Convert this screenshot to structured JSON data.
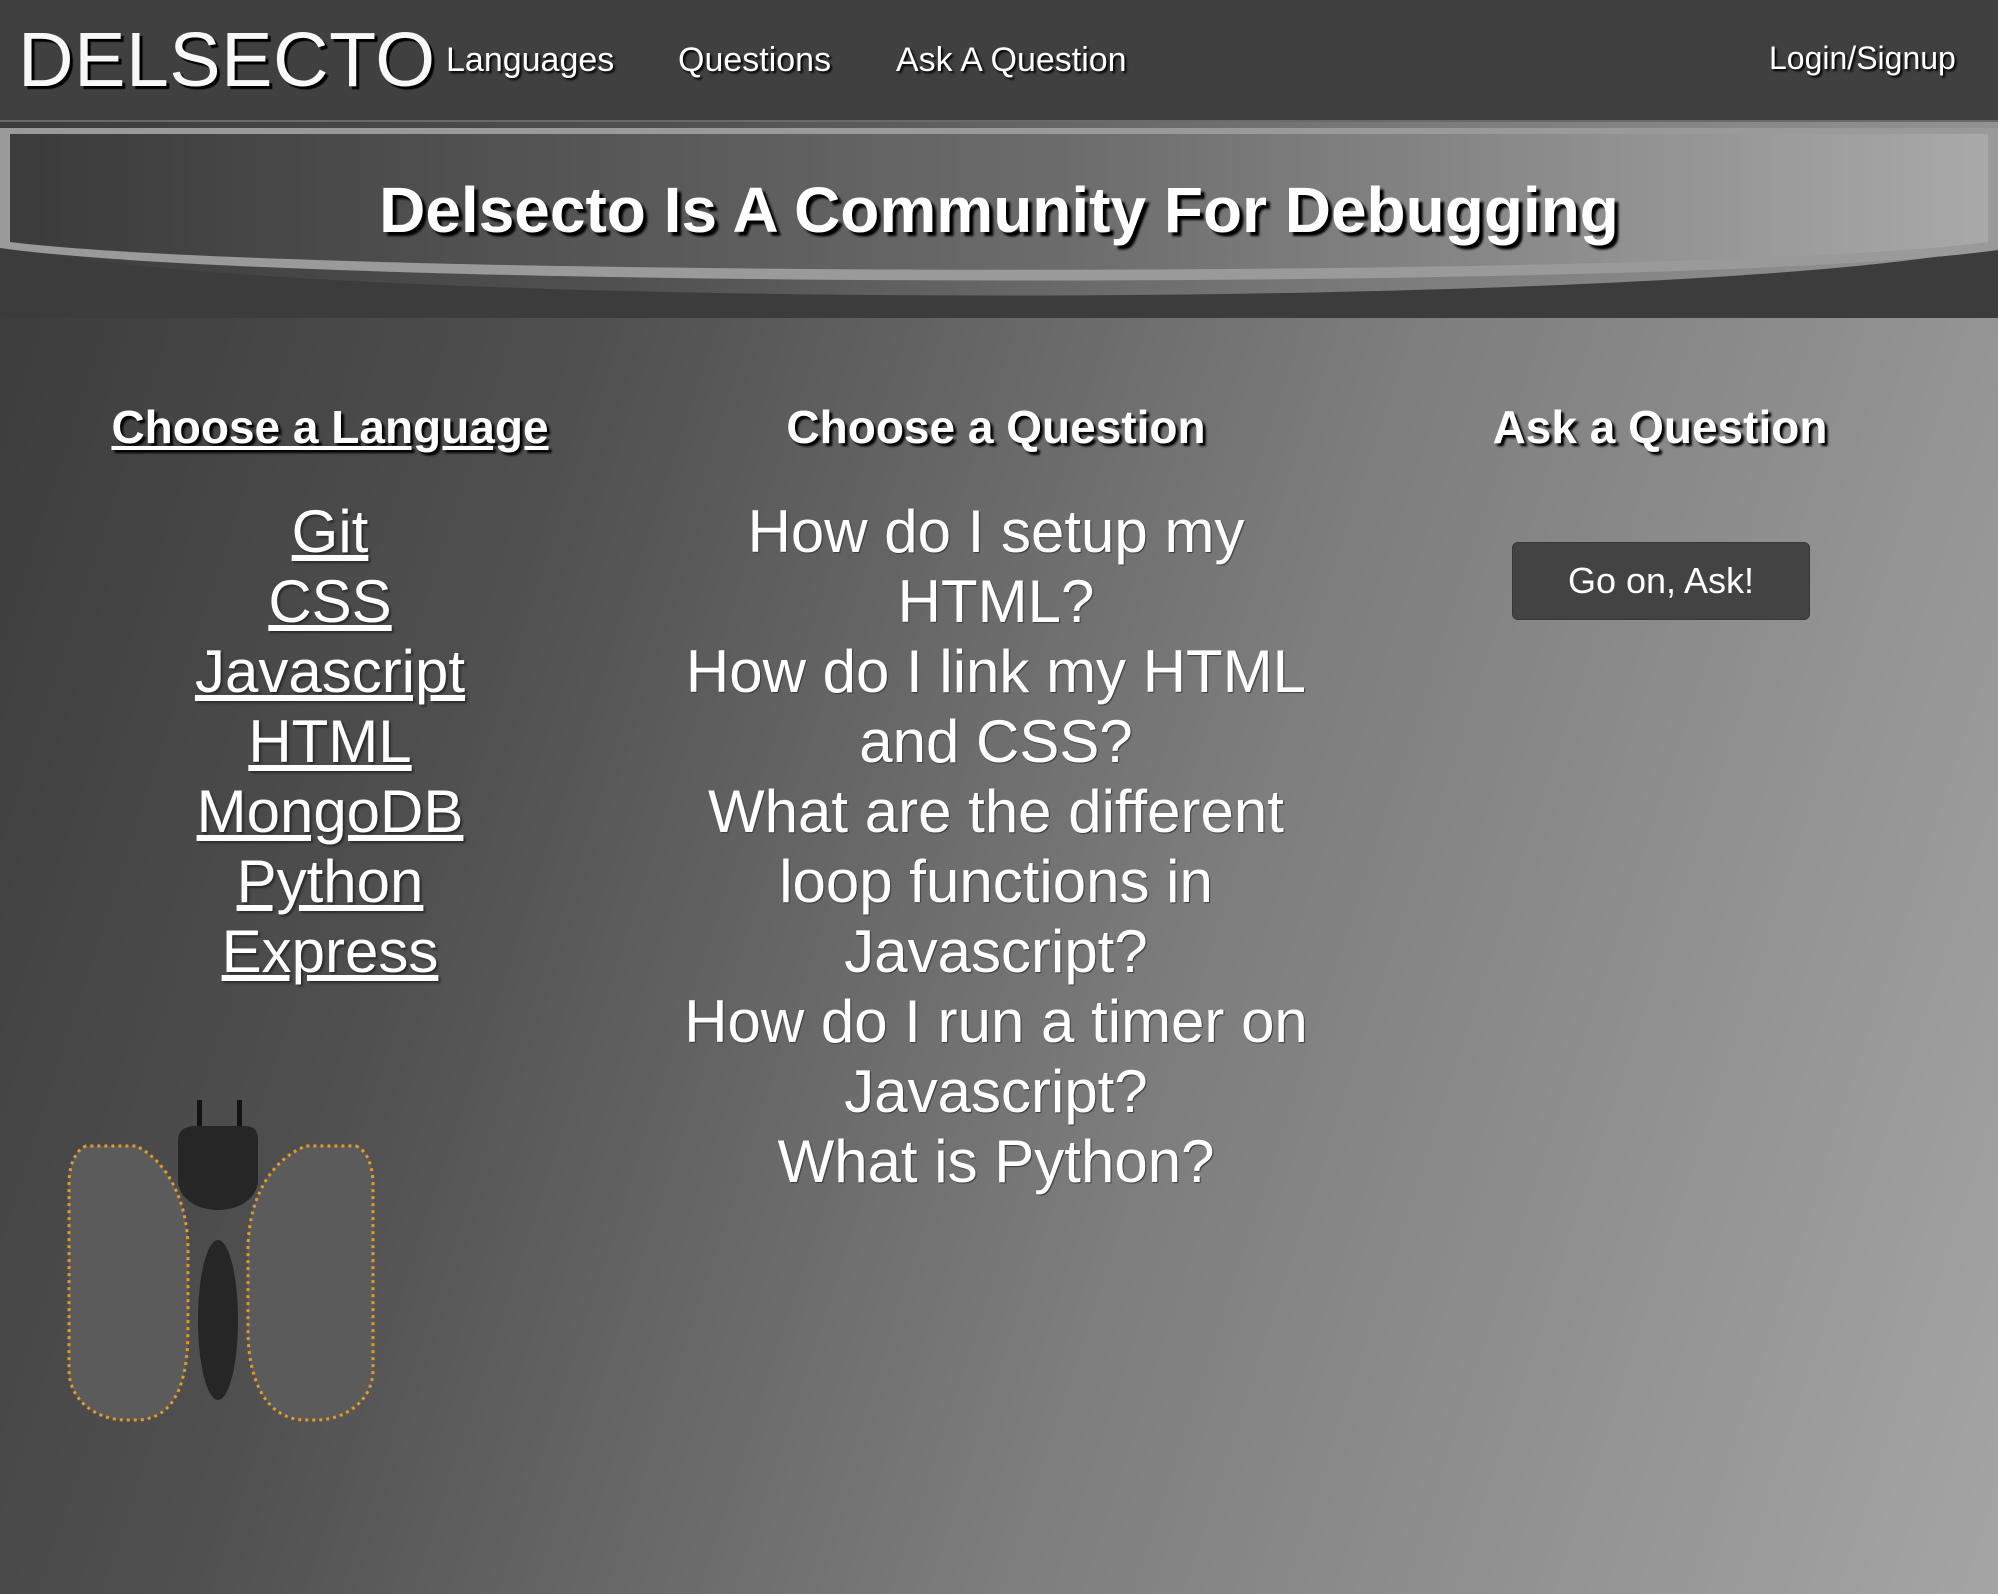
{
  "navbar": {
    "brand": "DELSECTO",
    "links": {
      "languages": "Languages",
      "questions": "Questions",
      "ask": "Ask A Question"
    },
    "login": "Login/Signup"
  },
  "hero": {
    "title": "Delsecto Is A Community For Debugging"
  },
  "languages_column": {
    "heading": "Choose a Language",
    "items": [
      "Git",
      "CSS",
      "Javascript",
      "HTML",
      "MongoDB",
      "Python",
      "Express"
    ]
  },
  "questions_column": {
    "heading": "Choose a Question",
    "items": [
      "How do I setup my HTML?",
      "How do I link my HTML and CSS?",
      "What are the different loop functions in Javascript?",
      "How do I run a timer on Javascript?",
      "What is Python?"
    ]
  },
  "ask_column": {
    "heading": "Ask a Question",
    "button_label": "Go on, Ask!"
  },
  "illustration": {
    "icon": "bug-icon",
    "wing_outline_color": "#e39a26"
  }
}
